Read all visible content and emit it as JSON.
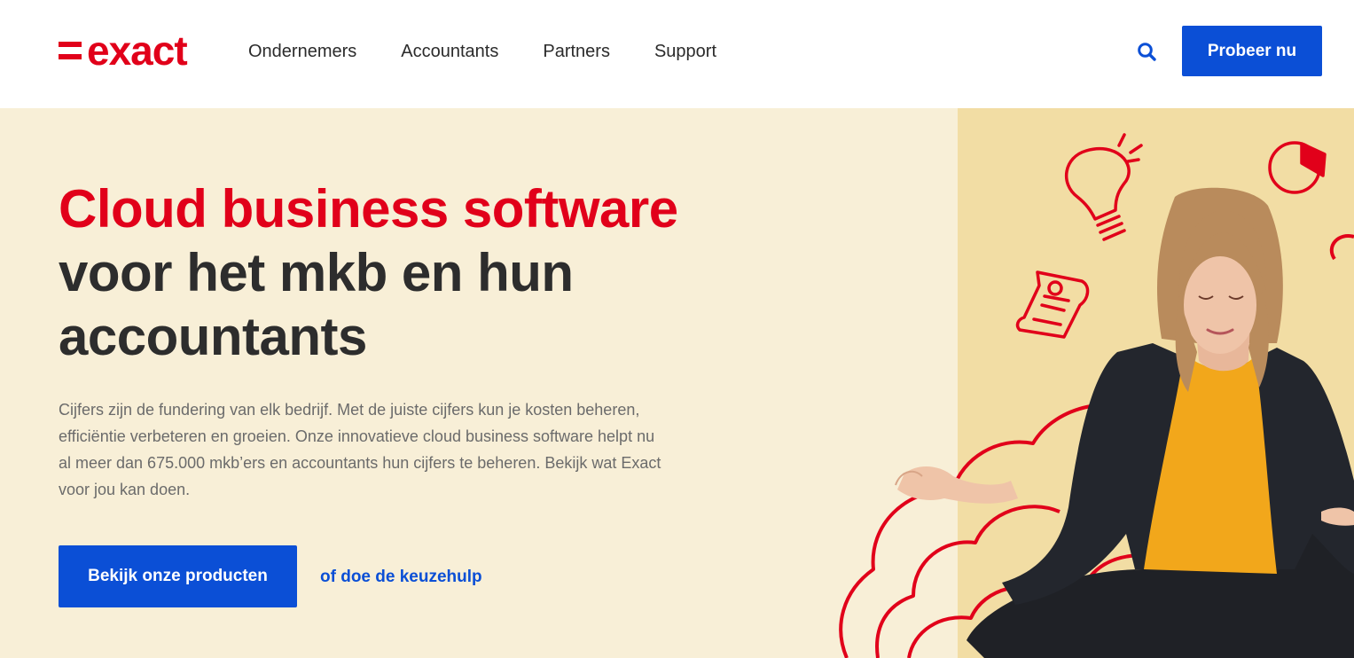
{
  "header": {
    "logo_text": "exact",
    "nav": [
      "Ondernemers",
      "Accountants",
      "Partners",
      "Support"
    ],
    "search_icon": "search-icon",
    "cta_label": "Probeer nu"
  },
  "hero": {
    "headline_red": "Cloud business software",
    "headline_dark": "voor het mkb en hun accountants",
    "intro": "Cijfers zijn de fundering van elk bedrijf. Met de juiste cijfers kun je kosten beheren, efficiëntie verbeteren en groeien. Onze innovatieve cloud business software helpt nu al meer dan 675.000 mkb’ers en accountants hun cijfers te beheren. Bekijk wat Exact voor jou kan doen.",
    "primary_button": "Bekijk onze producten",
    "secondary_link": "of doe de keuzehulp",
    "image_subject": "woman-meditating-on-clouds"
  },
  "colors": {
    "brand_red": "#e1001a",
    "primary_blue": "#0b4fd6",
    "hero_bg": "#f8efd7",
    "hero_shade": "#f2dda4"
  }
}
